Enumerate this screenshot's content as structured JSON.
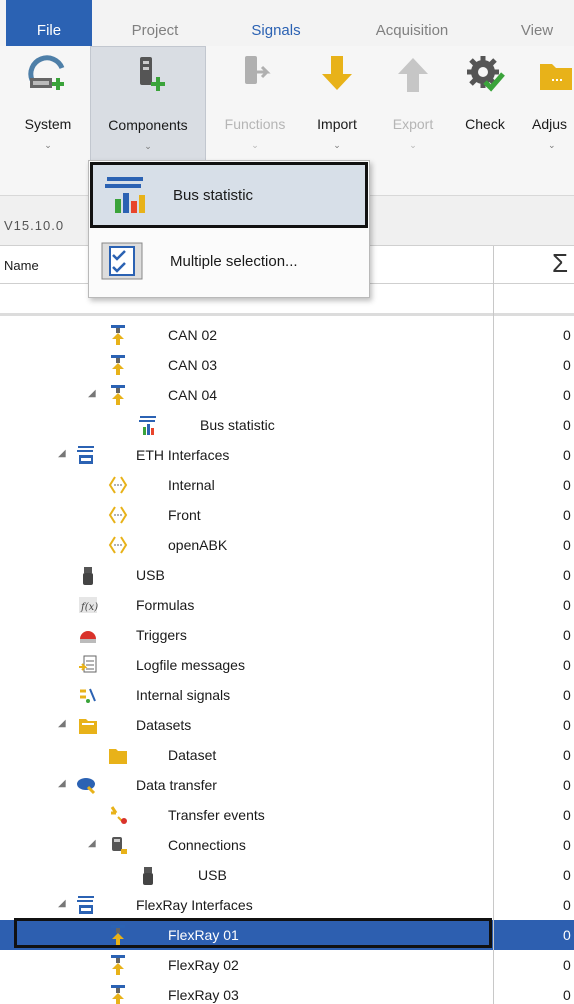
{
  "menu": {
    "tabs": [
      {
        "label": "File"
      },
      {
        "label": "Project"
      },
      {
        "label": "Signals"
      },
      {
        "label": "Acquisition"
      },
      {
        "label": "View"
      }
    ],
    "active_tab": "Signals"
  },
  "ribbon": {
    "buttons": [
      {
        "label": "System",
        "icon": "system-add-icon"
      },
      {
        "label": "Components",
        "icon": "components-add-icon"
      },
      {
        "label": "Functions",
        "icon": "functions-icon"
      },
      {
        "label": "Import",
        "icon": "import-arrow-icon"
      },
      {
        "label": "Export",
        "icon": "export-arrow-icon"
      },
      {
        "label": "Check",
        "icon": "check-gear-icon"
      },
      {
        "label": "Adjus",
        "icon": "adjust-folder-icon"
      }
    ],
    "dropdown_arrow": "⌄"
  },
  "components_menu": {
    "items": [
      {
        "label": "Bus statistic",
        "icon": "bus-statistic-icon"
      },
      {
        "label": "Multiple selection...",
        "icon": "multiple-selection-icon"
      }
    ]
  },
  "version": "V15.10.0",
  "grid": {
    "header_name": "Name",
    "header_sum": "Σ",
    "rows": [
      {
        "label": "CAN 02",
        "value": "0",
        "icon": "can-interface-icon"
      },
      {
        "label": "CAN 03",
        "value": "0",
        "icon": "can-interface-icon"
      },
      {
        "label": "CAN 04",
        "value": "0",
        "icon": "can-interface-icon"
      },
      {
        "label": "Bus statistic",
        "value": "0",
        "icon": "bus-statistic-icon"
      },
      {
        "label": "ETH Interfaces",
        "value": "0",
        "icon": "eth-interfaces-icon"
      },
      {
        "label": "Internal",
        "value": "0",
        "icon": "eth-port-icon"
      },
      {
        "label": "Front",
        "value": "0",
        "icon": "eth-port-icon"
      },
      {
        "label": "openABK",
        "value": "0",
        "icon": "eth-port-icon"
      },
      {
        "label": "USB",
        "value": "0",
        "icon": "usb-icon"
      },
      {
        "label": "Formulas",
        "value": "0",
        "icon": "formula-icon"
      },
      {
        "label": "Triggers",
        "value": "0",
        "icon": "trigger-icon"
      },
      {
        "label": "Logfile messages",
        "value": "0",
        "icon": "logfile-icon"
      },
      {
        "label": "Internal signals",
        "value": "0",
        "icon": "internal-signals-icon"
      },
      {
        "label": "Datasets",
        "value": "0",
        "icon": "datasets-folder-icon"
      },
      {
        "label": "Dataset",
        "value": "0",
        "icon": "dataset-folder-icon"
      },
      {
        "label": "Data transfer",
        "value": "0",
        "icon": "data-transfer-icon"
      },
      {
        "label": "Transfer events",
        "value": "0",
        "icon": "transfer-events-icon"
      },
      {
        "label": "Connections",
        "value": "0",
        "icon": "connections-icon"
      },
      {
        "label": "USB",
        "value": "0",
        "icon": "usb-icon"
      },
      {
        "label": "FlexRay Interfaces",
        "value": "0",
        "icon": "flexray-interfaces-icon"
      },
      {
        "label": "FlexRay 01",
        "value": "0",
        "icon": "flexray-interface-icon"
      },
      {
        "label": "FlexRay 02",
        "value": "0",
        "icon": "flexray-interface-icon"
      },
      {
        "label": "FlexRay 03",
        "value": "0",
        "icon": "flexray-interface-icon"
      }
    ],
    "expander": "◢"
  },
  "colors": {
    "accent": "#2b62b3",
    "selected_row": "#2d5fb0",
    "dropdown_highlight": "#d7dfe8"
  }
}
